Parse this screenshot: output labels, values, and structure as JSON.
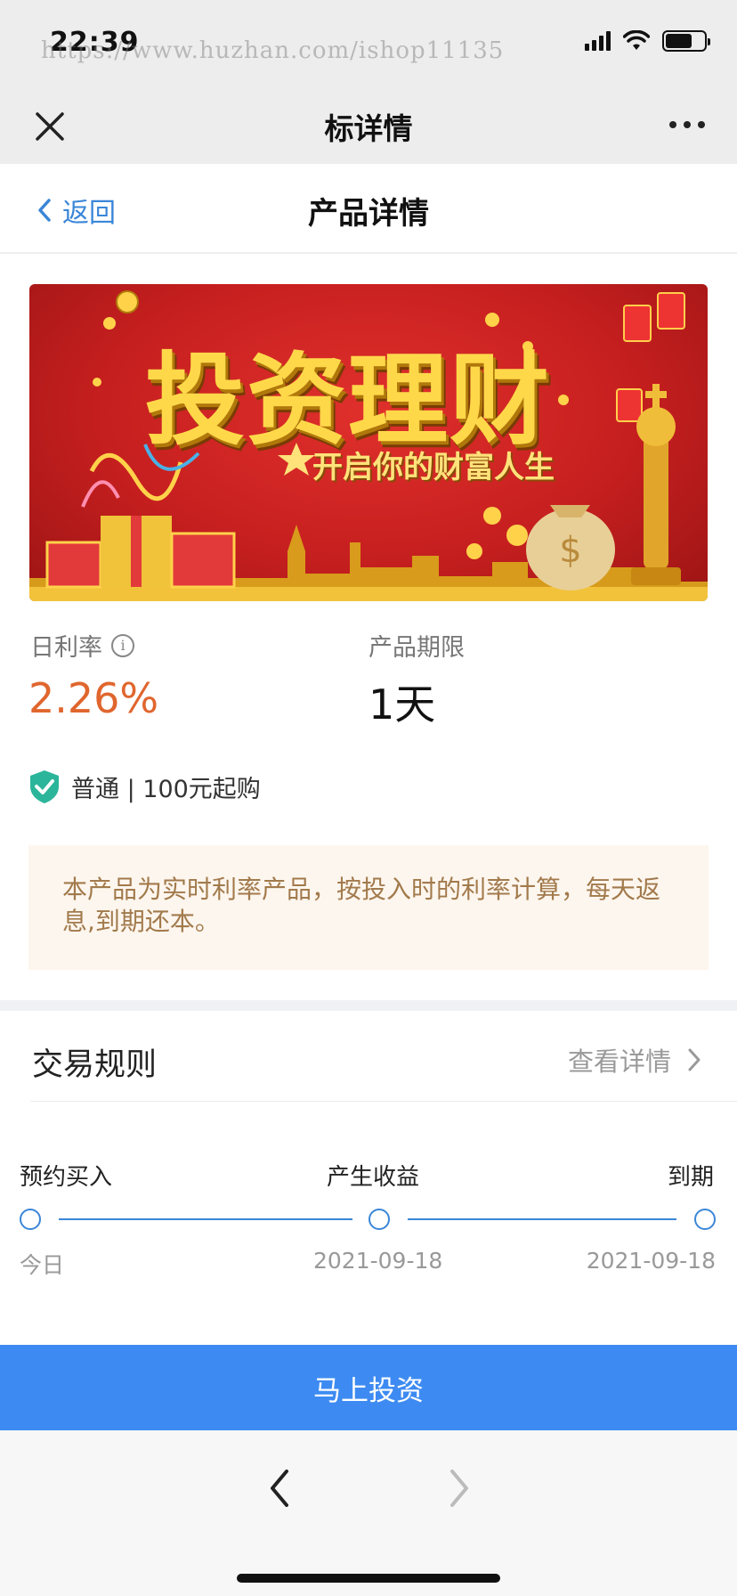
{
  "status_bar": {
    "time": "22:39",
    "watermark": "https://www.huzhan.com/ishop11135",
    "signal_icon": "signal-icon",
    "wifi_icon": "wifi-icon",
    "battery_icon": "battery-icon"
  },
  "wechat_header": {
    "title": "标详情",
    "close_icon": "close-icon",
    "more_icon": "more-icon"
  },
  "page_header": {
    "back_label": "返回",
    "title": "产品详情"
  },
  "banner": {
    "title": "投资理财",
    "subtitle": "开启你的财富人生"
  },
  "product": {
    "rate_label": "日利率",
    "rate_value": "2.26%",
    "term_label": "产品期限",
    "term_value": "1天",
    "tag_text": "普通 | 100元起购",
    "notice": "本产品为实时利率产品，按投入时的利率计算，每天返息,到期还本。"
  },
  "rules": {
    "title": "交易规则",
    "link_label": "查看详情",
    "steps": [
      {
        "label": "预约买入",
        "date": "今日"
      },
      {
        "label": "产生收益",
        "date": "2021-09-18"
      },
      {
        "label": "到期",
        "date": "2021-09-18"
      }
    ]
  },
  "action": {
    "invest_label": "马上投资"
  },
  "colors": {
    "accent_blue": "#3d8bf2",
    "rate_orange": "#e0662e",
    "notice_bg": "#fdf6ee",
    "banner_red": "#c61f1f"
  }
}
